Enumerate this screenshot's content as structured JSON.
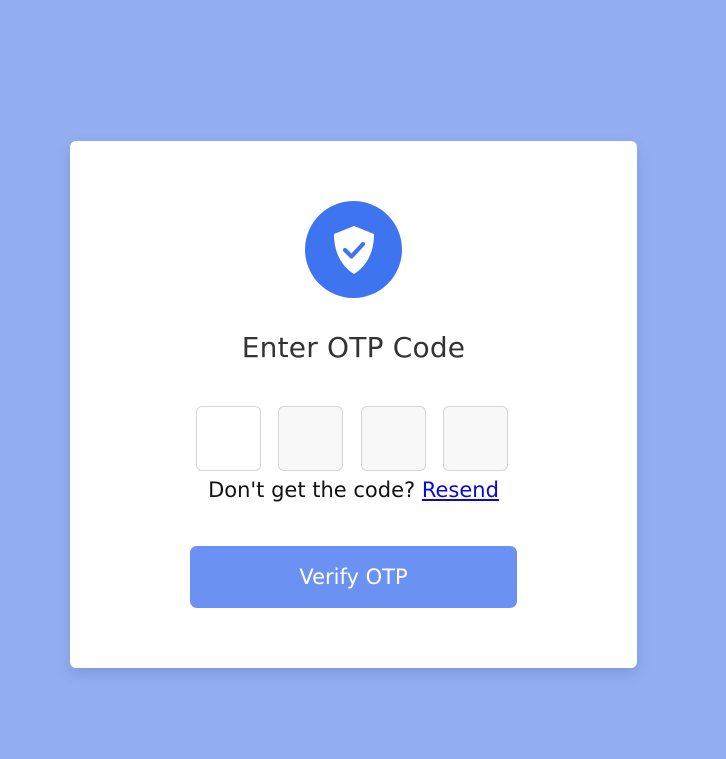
{
  "colors": {
    "page_background": "#93aef1",
    "card_background": "#ffffff",
    "accent": "#3f74f0",
    "button": "#6b91f3",
    "link": "#0a0ad6"
  },
  "header": {
    "icon": "shield-check-icon",
    "title": "Enter OTP Code"
  },
  "otp": {
    "digits": [
      "",
      "",
      "",
      ""
    ]
  },
  "resend": {
    "prompt": "Don't get the code?",
    "link_label": "Resend"
  },
  "actions": {
    "verify_label": "Verify OTP"
  }
}
